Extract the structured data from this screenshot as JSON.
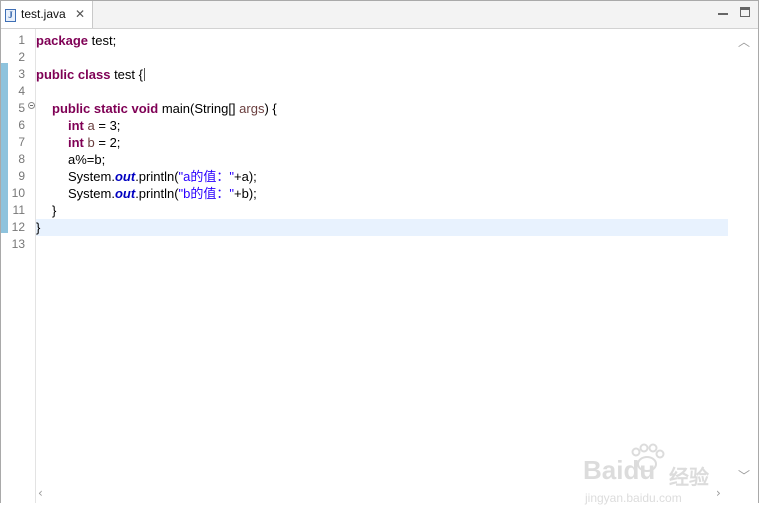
{
  "tab": {
    "filename": "test.java",
    "icon": "java-file-icon",
    "close_icon": "close-icon",
    "close_glyph": "✕"
  },
  "window_controls": {
    "minimize": "minimize-icon",
    "maximize": "maximize-icon"
  },
  "line_numbers": [
    "1",
    "2",
    "3",
    "4",
    "5",
    "6",
    "7",
    "8",
    "9",
    "10",
    "11",
    "12",
    "13"
  ],
  "code": {
    "line1": {
      "kw": "package",
      "rest": " test;"
    },
    "line3": {
      "kw1": "public",
      "kw2": "class",
      "rest": " test {"
    },
    "line5": {
      "kw1": "public",
      "kw2": "static",
      "kw3": "void",
      "mid": " main(String[] ",
      "param": "args",
      "end": ") {"
    },
    "line6": {
      "kw": "int",
      "var": "a",
      "rest": " = 3;"
    },
    "line7": {
      "kw": "int",
      "var": "b",
      "rest": " = 2;"
    },
    "line8": {
      "text": "a%=b;"
    },
    "line9": {
      "pre": "System.",
      "field": "out",
      "mid": ".println(",
      "str": "\"a的值：\"",
      "end": "+a);"
    },
    "line10": {
      "pre": "System.",
      "field": "out",
      "mid": ".println(",
      "str": "\"b的值：\"",
      "end": "+b);"
    },
    "line11": {
      "text": "}"
    },
    "line12": {
      "text": "}"
    }
  },
  "current_line": 12,
  "scroll": {
    "up": "chevron-up-icon",
    "down": "chevron-down-icon",
    "left": "chevron-left-icon",
    "right": "chevron-right-icon"
  },
  "watermark": {
    "brand": "Baidu",
    "brand_cn": "经验",
    "url": "jingyan.baidu.com"
  },
  "colors": {
    "keyword": "#7f0055",
    "string": "#2a00ff",
    "field": "#0000c0",
    "current_line": "#e8f2fe",
    "ruler": "#8ec3dd"
  }
}
